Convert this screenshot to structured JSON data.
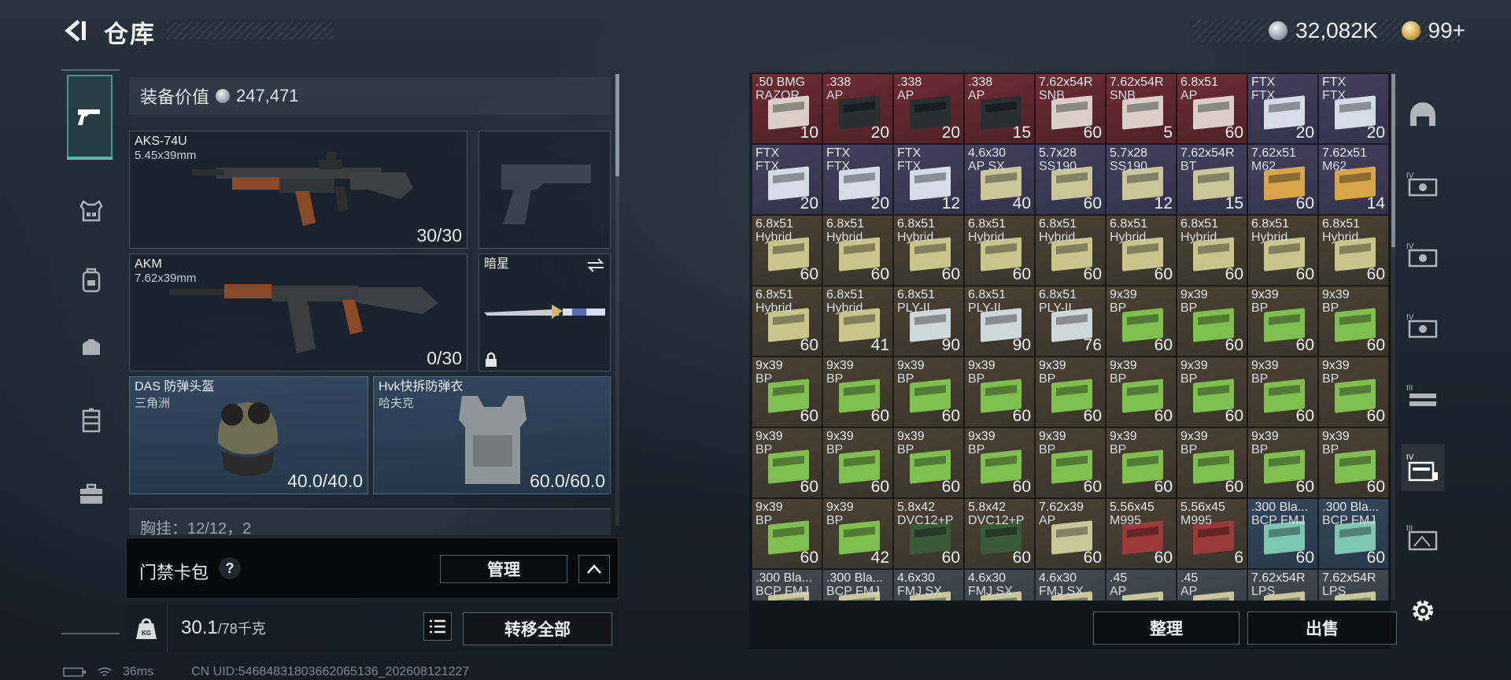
{
  "header": {
    "title": "仓库",
    "silver": "32,082K",
    "gold": "99+"
  },
  "colors": {
    "accent": "#3fc7a8",
    "panel_border": "#59636c"
  },
  "left_nav": [
    "pistol-icon",
    "vest-icon",
    "backpack-icon",
    "medkit-bag-icon",
    "locker-icon",
    "briefcase-icon"
  ],
  "loadout": {
    "value_label": "装备价值",
    "value": "247,471",
    "primary": {
      "name": "AKS-74U",
      "caliber": "5.45x39mm",
      "ammo": "30/30"
    },
    "secondary": {
      "name": "AKM",
      "caliber": "7.62x39mm",
      "ammo": "0/30"
    },
    "melee": {
      "name": "暗星"
    },
    "helmet": {
      "name": "DAS 防弹头盔",
      "origin": "三角洲",
      "durability": "40.0/40.0"
    },
    "armor": {
      "name": "Hvk快拆防弹衣",
      "origin": "哈夫克",
      "durability": "60.0/60.0"
    },
    "chest_peek": "胸挂：12/12，2"
  },
  "keycard": {
    "label": "门禁卡包",
    "help": "?",
    "manage": "管理"
  },
  "weight": {
    "current": "30.1",
    "max": "/78千克",
    "transfer_all": "转移全部"
  },
  "status": {
    "ping": "36ms",
    "uid": "CN UID:546848318036620651​36_202608121227"
  },
  "grid_actions": {
    "sort": "整理",
    "sell": "出售"
  },
  "items": [
    {
      "l1": ".50 BMG",
      "l2": "RAZOR",
      "q": "10",
      "c": "red"
    },
    {
      "l1": ".338",
      "l2": "AP",
      "q": "20",
      "c": "red"
    },
    {
      "l1": ".338",
      "l2": "AP",
      "q": "20",
      "c": "red"
    },
    {
      "l1": ".338",
      "l2": "AP",
      "q": "15",
      "c": "red"
    },
    {
      "l1": "7.62x54R",
      "l2": "SNB",
      "q": "60",
      "c": "red"
    },
    {
      "l1": "7.62x54R",
      "l2": "SNB",
      "q": "5",
      "c": "red"
    },
    {
      "l1": "6.8x51",
      "l2": "AP",
      "q": "60",
      "c": "red"
    },
    {
      "l1": "FTX",
      "l2": "FTX",
      "q": "20",
      "c": "purp"
    },
    {
      "l1": "FTX",
      "l2": "FTX",
      "q": "20",
      "c": "purp"
    },
    {
      "l1": "FTX",
      "l2": "FTX",
      "q": "20",
      "c": "purp"
    },
    {
      "l1": "FTX",
      "l2": "FTX",
      "q": "20",
      "c": "purp"
    },
    {
      "l1": "FTX",
      "l2": "FTX",
      "q": "12",
      "c": "purp"
    },
    {
      "l1": "4.6x30",
      "l2": "AP SX",
      "q": "40",
      "c": "purp"
    },
    {
      "l1": "5.7x28",
      "l2": "SS190",
      "q": "60",
      "c": "purp"
    },
    {
      "l1": "5.7x28",
      "l2": "SS190",
      "q": "12",
      "c": "purp"
    },
    {
      "l1": "7.62x54R",
      "l2": "BT",
      "q": "15",
      "c": "purp"
    },
    {
      "l1": "7.62x51",
      "l2": "M62",
      "q": "60",
      "c": "purp"
    },
    {
      "l1": "7.62x51",
      "l2": "M62",
      "q": "14",
      "c": "purp"
    },
    {
      "l1": "6.8x51",
      "l2": "Hybrid",
      "q": "60",
      "c": "brn"
    },
    {
      "l1": "6.8x51",
      "l2": "Hybrid",
      "q": "60",
      "c": "brn"
    },
    {
      "l1": "6.8x51",
      "l2": "Hybrid",
      "q": "60",
      "c": "brn"
    },
    {
      "l1": "6.8x51",
      "l2": "Hybrid",
      "q": "60",
      "c": "brn"
    },
    {
      "l1": "6.8x51",
      "l2": "Hybrid",
      "q": "60",
      "c": "brn"
    },
    {
      "l1": "6.8x51",
      "l2": "Hybrid",
      "q": "60",
      "c": "brn"
    },
    {
      "l1": "6.8x51",
      "l2": "Hybrid",
      "q": "60",
      "c": "brn"
    },
    {
      "l1": "6.8x51",
      "l2": "Hybrid",
      "q": "60",
      "c": "brn"
    },
    {
      "l1": "6.8x51",
      "l2": "Hybrid",
      "q": "60",
      "c": "brn"
    },
    {
      "l1": "6.8x51",
      "l2": "Hybrid",
      "q": "60",
      "c": "brn"
    },
    {
      "l1": "6.8x51",
      "l2": "Hybrid",
      "q": "41",
      "c": "brn"
    },
    {
      "l1": "6.8x51",
      "l2": "PLY-II",
      "q": "90",
      "c": "brn"
    },
    {
      "l1": "6.8x51",
      "l2": "PLY-II",
      "q": "90",
      "c": "brn"
    },
    {
      "l1": "6.8x51",
      "l2": "PLY-II",
      "q": "76",
      "c": "brn"
    },
    {
      "l1": "9x39",
      "l2": "BP",
      "q": "60",
      "c": "brn"
    },
    {
      "l1": "9x39",
      "l2": "BP",
      "q": "60",
      "c": "brn"
    },
    {
      "l1": "9x39",
      "l2": "BP",
      "q": "60",
      "c": "brn"
    },
    {
      "l1": "9x39",
      "l2": "BP",
      "q": "60",
      "c": "brn"
    },
    {
      "l1": "9x39",
      "l2": "BP",
      "q": "60",
      "c": "brn"
    },
    {
      "l1": "9x39",
      "l2": "BP",
      "q": "60",
      "c": "brn"
    },
    {
      "l1": "9x39",
      "l2": "BP",
      "q": "60",
      "c": "brn"
    },
    {
      "l1": "9x39",
      "l2": "BP",
      "q": "60",
      "c": "brn"
    },
    {
      "l1": "9x39",
      "l2": "BP",
      "q": "60",
      "c": "brn"
    },
    {
      "l1": "9x39",
      "l2": "BP",
      "q": "60",
      "c": "brn"
    },
    {
      "l1": "9x39",
      "l2": "BP",
      "q": "60",
      "c": "brn"
    },
    {
      "l1": "9x39",
      "l2": "BP",
      "q": "60",
      "c": "brn"
    },
    {
      "l1": "9x39",
      "l2": "BP",
      "q": "60",
      "c": "brn"
    },
    {
      "l1": "9x39",
      "l2": "BP",
      "q": "60",
      "c": "brn"
    },
    {
      "l1": "9x39",
      "l2": "BP",
      "q": "60",
      "c": "brn"
    },
    {
      "l1": "9x39",
      "l2": "BP",
      "q": "60",
      "c": "brn"
    },
    {
      "l1": "9x39",
      "l2": "BP",
      "q": "60",
      "c": "brn"
    },
    {
      "l1": "9x39",
      "l2": "BP",
      "q": "60",
      "c": "brn"
    },
    {
      "l1": "9x39",
      "l2": "BP",
      "q": "60",
      "c": "brn"
    },
    {
      "l1": "9x39",
      "l2": "BP",
      "q": "60",
      "c": "brn"
    },
    {
      "l1": "9x39",
      "l2": "BP",
      "q": "60",
      "c": "brn"
    },
    {
      "l1": "9x39",
      "l2": "BP",
      "q": "60",
      "c": "brn"
    },
    {
      "l1": "9x39",
      "l2": "BP",
      "q": "60",
      "c": "brn"
    },
    {
      "l1": "9x39",
      "l2": "BP",
      "q": "42",
      "c": "brn"
    },
    {
      "l1": "5.8x42",
      "l2": "DVC12+P",
      "q": "60",
      "c": "brn"
    },
    {
      "l1": "5.8x42",
      "l2": "DVC12+P",
      "q": "60",
      "c": "brn"
    },
    {
      "l1": "7.62x39",
      "l2": "AP",
      "q": "60",
      "c": "brn"
    },
    {
      "l1": "5.56x45",
      "l2": "M995",
      "q": "60",
      "c": "brn"
    },
    {
      "l1": "5.56x45",
      "l2": "M995",
      "q": "6",
      "c": "brn"
    },
    {
      "l1": ".300 Bla...",
      "l2": "BCP FMJ",
      "q": "60",
      "c": "blu"
    },
    {
      "l1": ".300 Bla...",
      "l2": "BCP FMJ",
      "q": "60",
      "c": "blu"
    },
    {
      "l1": ".300 Bla...",
      "l2": "BCP FMJ",
      "q": "",
      "c": "gry"
    },
    {
      "l1": ".300 Bla...",
      "l2": "BCP FMJ",
      "q": "",
      "c": "gry"
    },
    {
      "l1": "4.6x30",
      "l2": "FMJ SX",
      "q": "",
      "c": "gry"
    },
    {
      "l1": "4.6x30",
      "l2": "FMJ SX",
      "q": "",
      "c": "gry"
    },
    {
      "l1": "4.6x30",
      "l2": "FMJ SX",
      "q": "",
      "c": "gry"
    },
    {
      "l1": ".45",
      "l2": "AP",
      "q": "",
      "c": "gry"
    },
    {
      "l1": ".45",
      "l2": "AP",
      "q": "",
      "c": "gry"
    },
    {
      "l1": "7.62x54R",
      "l2": "LPS",
      "q": "",
      "c": "gry"
    },
    {
      "l1": "7.62x54R",
      "l2": "LPS",
      "q": "",
      "c": "gry"
    }
  ],
  "right_rail": [
    "helmet-slot-icon",
    "level-4-box-icon",
    "level-4-box-icon",
    "level-4-box-icon",
    "level-3-rack-icon",
    "level-4-case-icon",
    "level-3-crate-icon",
    "settings-gear-icon"
  ]
}
